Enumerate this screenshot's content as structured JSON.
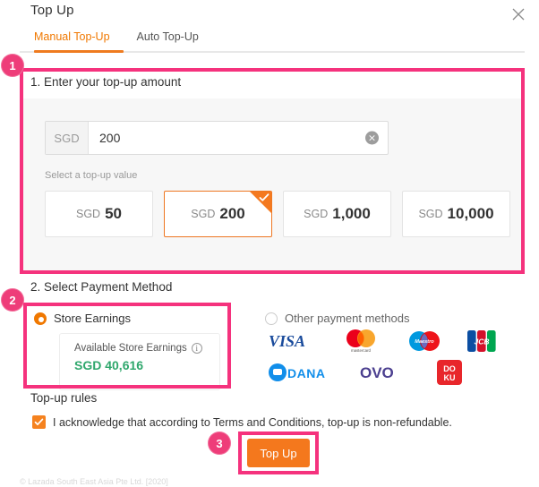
{
  "dialog": {
    "title": "Top Up",
    "close_icon": "close-icon"
  },
  "tabs": [
    {
      "label": "Manual Top-Up",
      "active": true
    },
    {
      "label": "Auto Top-Up",
      "active": false
    }
  ],
  "steps": [
    {
      "number": "1"
    },
    {
      "number": "2"
    },
    {
      "number": "3"
    }
  ],
  "section1": {
    "title": "1. Enter your top-up amount",
    "currency_prefix": "SGD",
    "amount_value": "200",
    "amount_placeholder": "",
    "clear_icon": "×",
    "hint": "Select a top-up value",
    "presets": [
      {
        "currency": "SGD",
        "value": "50",
        "selected": false
      },
      {
        "currency": "SGD",
        "value": "200",
        "selected": true
      },
      {
        "currency": "SGD",
        "value": "1,000",
        "selected": false
      },
      {
        "currency": "SGD",
        "value": "10,000",
        "selected": false
      }
    ]
  },
  "section2": {
    "title": "2. Select Payment Method",
    "store_earnings": {
      "label": "Store Earnings",
      "selected": true,
      "balance_label": "Available Store Earnings",
      "info_icon": "i",
      "balance_value": "SGD 40,616",
      "balance_color": "#2fa76c"
    },
    "other_methods": {
      "label": "Other payment methods",
      "selected": false,
      "logos": [
        "VISA",
        "mastercard",
        "Maestro",
        "JCB",
        "DANA",
        "OVO",
        "DOKU"
      ]
    }
  },
  "rules": {
    "title": "Top-up rules",
    "acknowledge_text": "I acknowledge that according to Terms and Conditions, top-up is non-refundable.",
    "checked": true
  },
  "submit": {
    "label": "Top Up"
  },
  "footer": {
    "text": "© Lazada South East Asia Pte Ltd. [2020]"
  },
  "colors": {
    "accent_orange": "#f4781d",
    "annotation_pink": "#f5327d",
    "balance_green": "#2fa76c"
  }
}
